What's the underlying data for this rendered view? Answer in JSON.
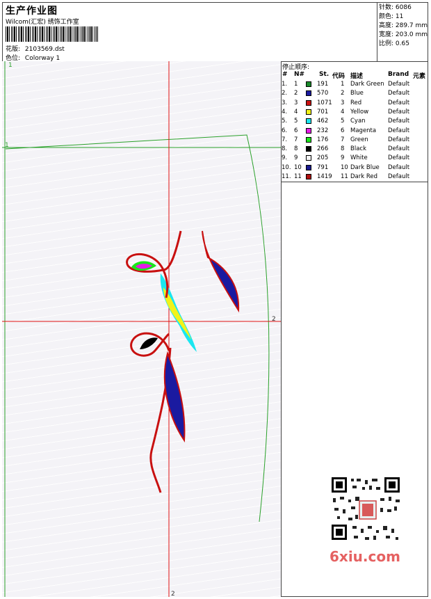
{
  "header": {
    "title": "生产作业图",
    "subtitle": "Wilcom(汇宏) 绣饰工作室",
    "design_label": "花版:",
    "design_value": "2103569.dst",
    "colorway_label": "色位:",
    "colorway_value": "Colorway 1"
  },
  "stats": {
    "stitches": "针数: 6086",
    "colors": "颜色: 11",
    "height": "高度: 289.7 mm",
    "width": "宽度: 203.0 mm",
    "scale": "比例: 0.65"
  },
  "stop_sequence": {
    "title": "停止顺序:",
    "headers": {
      "hash": "#",
      "num": "N#",
      "st": "St.",
      "code": "代码",
      "desc": "描述",
      "brand": "Brand",
      "element": "元素"
    },
    "rows": [
      {
        "idx": "1.",
        "n": "1",
        "color": "#1a8a2a",
        "st": "191",
        "code": "1",
        "desc": "Dark Green",
        "brand": "Default"
      },
      {
        "idx": "2.",
        "n": "2",
        "color": "#1a1aa0",
        "st": "570",
        "code": "2",
        "desc": "Blue",
        "brand": "Default"
      },
      {
        "idx": "3.",
        "n": "3",
        "color": "#cc1111",
        "st": "1071",
        "code": "3",
        "desc": "Red",
        "brand": "Default"
      },
      {
        "idx": "4.",
        "n": "4",
        "color": "#f2f21a",
        "st": "701",
        "code": "4",
        "desc": "Yellow",
        "brand": "Default"
      },
      {
        "idx": "5.",
        "n": "5",
        "color": "#1ae6f0",
        "st": "462",
        "code": "5",
        "desc": "Cyan",
        "brand": "Default"
      },
      {
        "idx": "6.",
        "n": "6",
        "color": "#e61ae6",
        "st": "232",
        "code": "6",
        "desc": "Magenta",
        "brand": "Default"
      },
      {
        "idx": "7.",
        "n": "7",
        "color": "#1ae61a",
        "st": "176",
        "code": "7",
        "desc": "Green",
        "brand": "Default"
      },
      {
        "idx": "8.",
        "n": "8",
        "color": "#000000",
        "st": "266",
        "code": "8",
        "desc": "Black",
        "brand": "Default"
      },
      {
        "idx": "9.",
        "n": "9",
        "color": "#f4f4f4",
        "st": "205",
        "code": "9",
        "desc": "White",
        "brand": "Default"
      },
      {
        "idx": "10.",
        "n": "10",
        "color": "#1a1a90",
        "st": "791",
        "code": "10",
        "desc": "Dark Blue",
        "brand": "Default"
      },
      {
        "idx": "11.",
        "n": "11",
        "color": "#b01010",
        "st": "1419",
        "code": "11",
        "desc": "Dark Red",
        "brand": "Default"
      }
    ]
  },
  "canvas": {
    "marker_1": "1",
    "marker_2": "2"
  },
  "watermark": "6xiu.com",
  "colors": {
    "frame_green": "#2aa12a",
    "axis_red": "#e01010",
    "watermark": "#e56161"
  }
}
